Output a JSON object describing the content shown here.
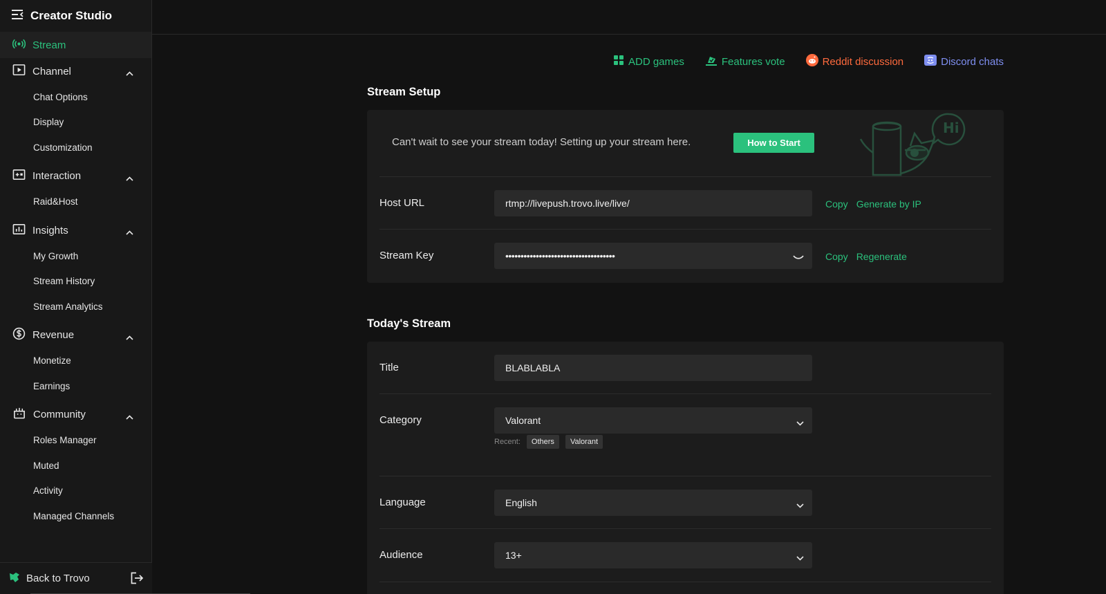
{
  "sidebar": {
    "title": "Creator Studio",
    "stream_label": "Stream",
    "groups": [
      {
        "label": "Channel",
        "items": [
          "Chat Options",
          "Display",
          "Customization"
        ]
      },
      {
        "label": "Interaction",
        "items": [
          "Raid&Host"
        ]
      },
      {
        "label": "Insights",
        "items": [
          "My Growth",
          "Stream History",
          "Stream Analytics"
        ]
      },
      {
        "label": "Revenue",
        "items": [
          "Monetize",
          "Earnings"
        ]
      },
      {
        "label": "Community",
        "items": [
          "Roles Manager",
          "Muted",
          "Activity",
          "Managed Channels"
        ]
      }
    ],
    "footer_label": "Back to Trovo"
  },
  "links": {
    "add_games": "ADD games",
    "features_vote": "Features vote",
    "reddit": "Reddit discussion",
    "discord": "Discord chats"
  },
  "setup": {
    "title": "Stream Setup",
    "message": "Can't wait to see your stream today! Setting up your stream here.",
    "how_button": "How to Start",
    "illustration_text": "Hi",
    "host_label": "Host URL",
    "host_value": "rtmp://livepush.trovo.live/live/",
    "host_copy": "Copy",
    "host_generate": "Generate by IP",
    "key_label": "Stream Key",
    "key_value": "••••••••••••••••••••••••••••••••••••",
    "key_copy": "Copy",
    "key_regenerate": "Regenerate"
  },
  "today": {
    "title": "Today's Stream",
    "title_label": "Title",
    "title_value": "BLABLABLA",
    "category_label": "Category",
    "category_value": "Valorant",
    "recent_label": "Recent:",
    "recent_tags": [
      "Others",
      "Valorant"
    ],
    "language_label": "Language",
    "language_value": "English",
    "audience_label": "Audience",
    "audience_value": "13+"
  },
  "colors": {
    "accent": "#2bc17d",
    "reddit": "#ff6a3d",
    "discord": "#7e8ef0",
    "background": "#121212",
    "card": "#1c1c1c"
  }
}
